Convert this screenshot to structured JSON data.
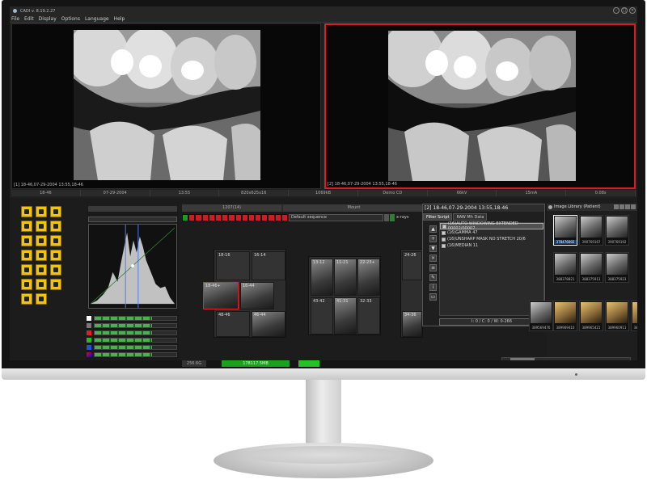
{
  "window": {
    "title": "CADI v. 8.19.2.27"
  },
  "menu": [
    "File",
    "Edit",
    "Display",
    "Options",
    "Language",
    "Help"
  ],
  "viewers": [
    {
      "caption": "[1] 18-46,07-29-2004 13:55,18-46"
    },
    {
      "caption": "[2] 18-46,07-29-2004 13:55,18-46"
    }
  ],
  "infobar": [
    "18-46",
    "07-29-2004",
    "13:55",
    "820x625x16",
    "1069kB",
    "Demo CD",
    "66kV",
    "15mA",
    "0.08s"
  ],
  "histogram": {
    "top_label": "1207(14)"
  },
  "mount": {
    "title": "Mount",
    "sequence": "Default sequence",
    "xrays_label": "x-rays"
  },
  "mount_groups": [
    {
      "cells": [
        "18-16",
        "16-14",
        "18-46+",
        "16-44",
        "48-46",
        "46-44"
      ]
    },
    {
      "cells": [
        "13-12",
        "11-21",
        "22-23+",
        "43-42",
        "41-31",
        "32-33"
      ]
    },
    {
      "cells": [
        "24-26",
        "34-36"
      ]
    }
  ],
  "filter_panel": {
    "title": "[2] 18-46,07-29-2004 13:55,18-46",
    "tabs": [
      "Filter Script",
      "RAW Mh Data"
    ],
    "items": [
      "(16)AUTO WINDOWING EXTENDED 00002/00007",
      "(16)GAMMA 47",
      "(16)UNSHARP MASK NO STRETCH 20/6",
      "(16)MEDIAN 11"
    ],
    "status": "I: 0 / C: 0 / W: 0-266"
  },
  "library": {
    "title": "Image Library (Patient)",
    "thumbs": [
      "378476002",
      "390769167",
      "390769192",
      "388378821",
      "388375913",
      "388375923",
      "389569476",
      "389969410",
      "389965421",
      "389960911",
      "389474329"
    ]
  },
  "statusbar": {
    "a": "256.6G",
    "b": "178117.5MB"
  }
}
